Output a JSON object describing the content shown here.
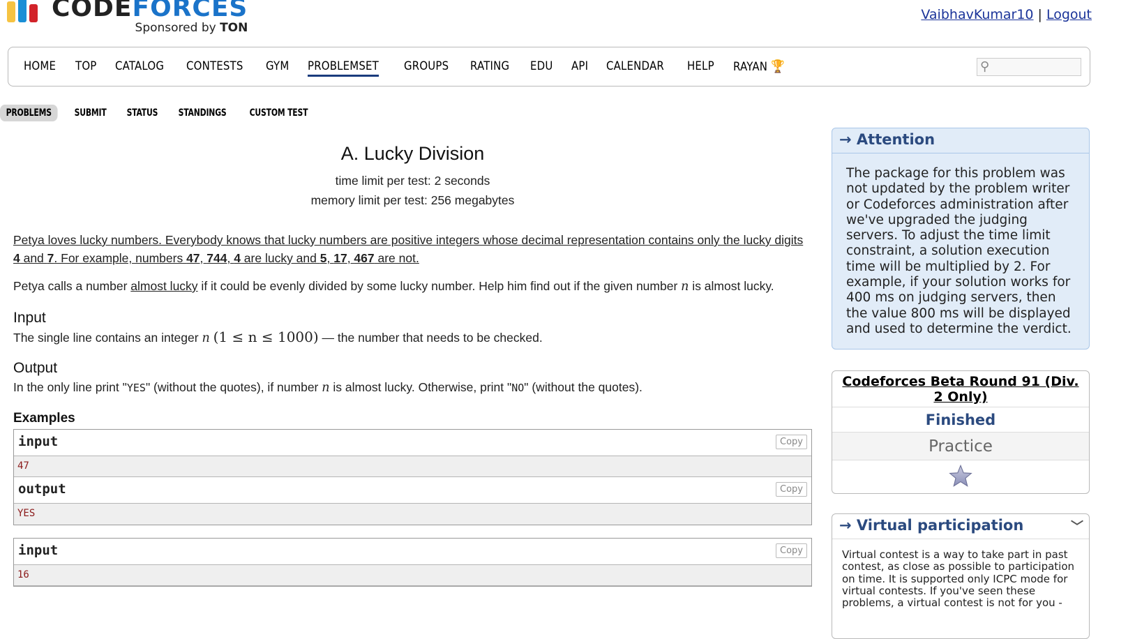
{
  "header": {
    "brand_code": "CODE",
    "brand_forces": "FORCES",
    "sponsor_prefix": "Sponsored by ",
    "sponsor_name": "TON",
    "username": "VaibhavKumar10",
    "separator": "|",
    "logout": "Logout"
  },
  "menu": {
    "items": [
      "HOME",
      "TOP",
      "CATALOG",
      "CONTESTS",
      "GYM",
      "PROBLEMSET",
      "GROUPS",
      "RATING",
      "EDU",
      "API",
      "CALENDAR",
      "HELP",
      "RAYAN"
    ],
    "active": "PROBLEMSET",
    "search_icon": "magnifier-icon",
    "trophy_icon": "trophy-icon"
  },
  "subnav": {
    "items": [
      "PROBLEMS",
      "SUBMIT",
      "STATUS",
      "STANDINGS",
      "CUSTOM TEST"
    ],
    "active": "PROBLEMS"
  },
  "problem": {
    "title": "A. Lucky Division",
    "time_limit": "time limit per test: 2 seconds",
    "memory_limit": "memory limit per test: 256 megabytes",
    "p1_a": "Petya loves lucky numbers. Everybody knows that lucky numbers are positive integers whose decimal representation contains only the lucky digits ",
    "p1_d4": "4",
    "p1_and": " and ",
    "p1_d7": "7",
    "p1_b": ". For example, numbers ",
    "p1_n47": "47",
    "p1_c1": ", ",
    "p1_n744": "744",
    "p1_c2": ", ",
    "p1_n4": "4",
    "p1_mid": " are lucky and ",
    "p1_n5": "5",
    "p1_c3": ", ",
    "p1_n17": "17",
    "p1_c4": ", ",
    "p1_n467": "467",
    "p1_end": " are not.",
    "p2_a": "Petya calls a number ",
    "p2_link": "almost lucky",
    "p2_b": " if it could be evenly divided by some lucky number. Help him find out if the given number ",
    "p2_var": "n",
    "p2_c": " is almost lucky.",
    "input_title": "Input",
    "input_a": "The single line contains an integer ",
    "input_var": "n",
    "input_math": "(1 ≤ n ≤ 1000)",
    "input_b": " — the number that needs to be checked.",
    "output_title": "Output",
    "output_a": "In the only line print \"",
    "output_yes": "YES",
    "output_b": "\" (without the quotes), if number ",
    "output_var": "n",
    "output_c": " is almost lucky. Otherwise, print \"",
    "output_no": "NO",
    "output_d": "\" (without the quotes).",
    "examples_title": "Examples",
    "examples": [
      {
        "input_label": "input",
        "input": "47",
        "output_label": "output",
        "output": "YES"
      },
      {
        "input_label": "input",
        "input": "16"
      }
    ],
    "copy_label": "Copy"
  },
  "sidebar": {
    "attention_title": "→ Attention",
    "attention_body": "The package for this problem was not updated by the problem writer or Codeforces administration after we've upgraded the judging servers. To adjust the time limit constraint, a solution execution time will be multiplied by 2. For example, if your solution works for 400 ms on judging servers, then the value 800 ms will be displayed and used to determine the verdict.",
    "round_name": "Codeforces Beta Round 91 (Div. 2 Only)",
    "round_status": "Finished",
    "round_mode": "Practice",
    "star_icon": "star-icon",
    "vp_title": "→ Virtual participation",
    "vp_body": "Virtual contest is a way to take part in past contest, as close as possible to participation on time. It is supported only ICPC mode for virtual contests. If you've seen these problems, a virtual contest is not for you -"
  }
}
